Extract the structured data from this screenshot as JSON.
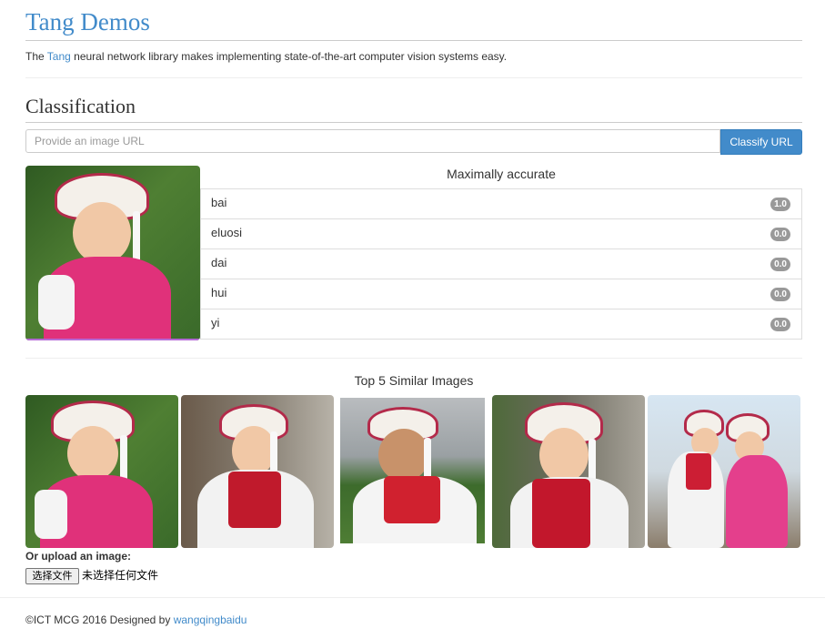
{
  "header": {
    "title": "Tang Demos",
    "intro_prefix": "The ",
    "intro_link": "Tang",
    "intro_suffix": " neural network library makes implementing state-of-the-art computer vision systems easy."
  },
  "classification": {
    "heading": "Classification",
    "url_placeholder": "Provide an image URL",
    "url_value": "",
    "classify_button": "Classify URL",
    "results_title": "Maximally accurate",
    "results": [
      {
        "label": "bai",
        "score": "1.0"
      },
      {
        "label": "eluosi",
        "score": "0.0"
      },
      {
        "label": "dai",
        "score": "0.0"
      },
      {
        "label": "hui",
        "score": "0.0"
      },
      {
        "label": "yi",
        "score": "0.0"
      }
    ]
  },
  "similar": {
    "title": "Top 5 Similar Images",
    "images": [
      {
        "name": "similar-image-1"
      },
      {
        "name": "similar-image-2"
      },
      {
        "name": "similar-image-3"
      },
      {
        "name": "similar-image-4"
      },
      {
        "name": "similar-image-5"
      }
    ]
  },
  "upload": {
    "label": "Or upload an image:",
    "button": "选择文件",
    "status": "未选择任何文件"
  },
  "footer": {
    "text": "©ICT MCG 2016 Designed by ",
    "link": "wangqingbaidu"
  },
  "colors": {
    "accent": "#428bca",
    "badge": "#999999"
  }
}
